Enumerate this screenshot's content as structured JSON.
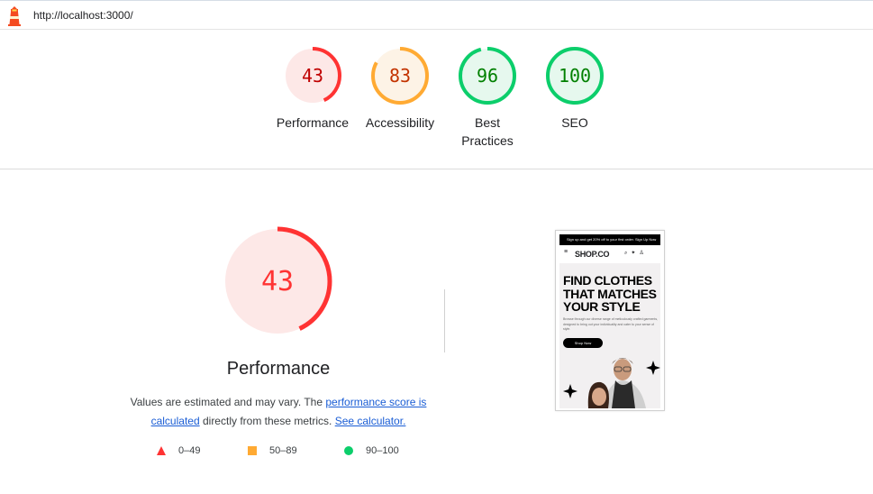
{
  "url": "http://localhost:3000/",
  "categories": [
    {
      "label": "Performance",
      "score": "43",
      "fraction": 0.43,
      "color": "#ff3333",
      "fill": "#fde8e7",
      "text_color": "#c00000"
    },
    {
      "label": "Accessibility",
      "score": "83",
      "fraction": 0.83,
      "color": "#ffaa33",
      "fill": "#fdf3e6",
      "text_color": "#c33300"
    },
    {
      "label_line1": "Best",
      "label_line2": "Practices",
      "score": "96",
      "fraction": 0.96,
      "color": "#0cce6b",
      "fill": "#e6f8ee",
      "text_color": "#008000"
    },
    {
      "label": "SEO",
      "score": "100",
      "fraction": 1.0,
      "color": "#0cce6b",
      "fill": "#e6f8ee",
      "text_color": "#008000"
    }
  ],
  "performance": {
    "score": "43",
    "fraction": 0.43,
    "title": "Performance",
    "desc_part1": "Values are estimated and may vary. The ",
    "desc_link1": "performance score is calculated",
    "desc_part2": " directly from these metrics. ",
    "desc_link2": "See calculator."
  },
  "legend": [
    {
      "range": "0–49",
      "shape": "triangle",
      "color": "#ff3333"
    },
    {
      "range": "50–89",
      "shape": "square",
      "color": "#ffaa33"
    },
    {
      "range": "90–100",
      "shape": "circle",
      "color": "#0cce6b"
    }
  ],
  "thumbnail": {
    "promo": "Sign up and get 20% off to your first order.  Sign Up Now",
    "brand": "SHOP.CO",
    "hero_line1": "FIND CLOTHES",
    "hero_line2": "THAT MATCHES",
    "hero_line3": "YOUR STYLE",
    "hero_desc": "Browse through our diverse range of meticulously crafted garments, designed to bring out your individuality and cater to your sense of style.",
    "button": "Shop Now"
  }
}
